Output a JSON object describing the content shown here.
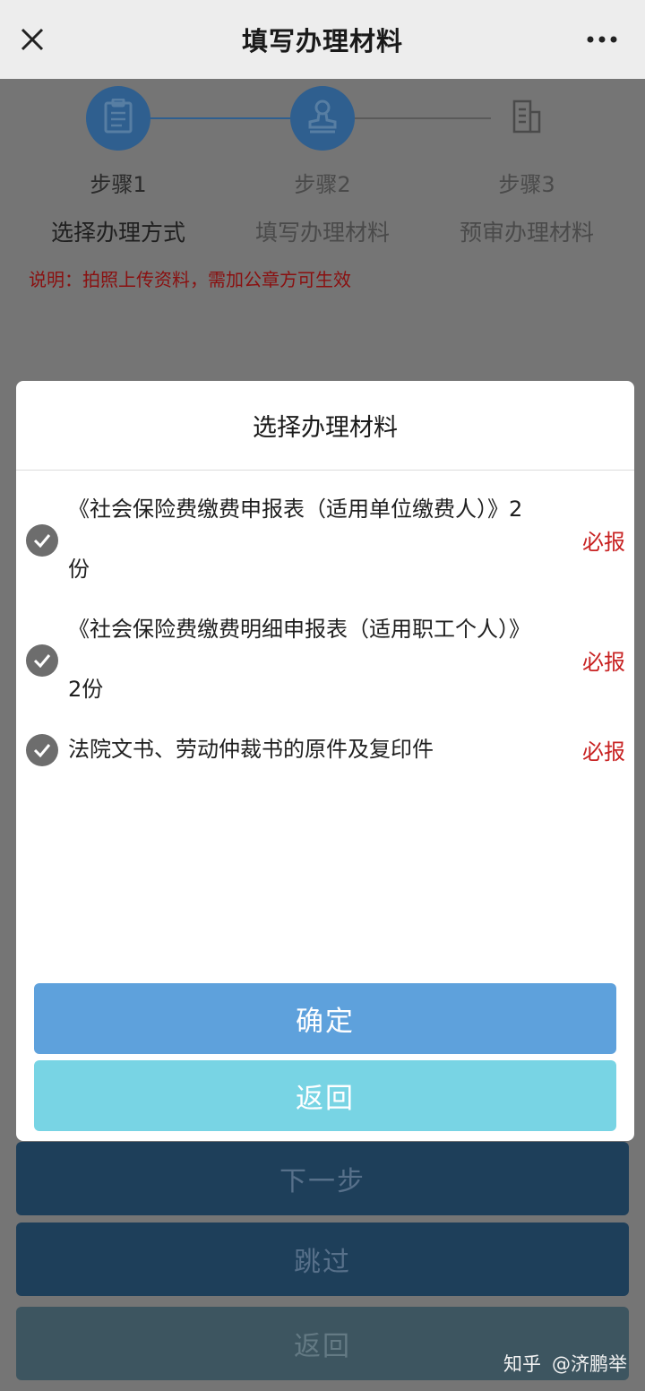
{
  "topbar": {
    "title": "填写办理材料",
    "close_icon": "close-icon",
    "more_icon": "more-icon"
  },
  "steps": [
    {
      "number": "步骤1",
      "name": "选择办理方式",
      "icon": "clipboard-icon",
      "active": true
    },
    {
      "number": "步骤2",
      "name": "填写办理材料",
      "icon": "stamp-icon",
      "active": true
    },
    {
      "number": "步骤3",
      "name": "预审办理材料",
      "icon": "document-icon",
      "active": false
    }
  ],
  "note": "说明：拍照上传资料，需加公章方可生效",
  "background_buttons": {
    "next": "下一步",
    "skip": "跳过",
    "back": "返回"
  },
  "watermark": {
    "site": "知乎",
    "author": "@济鹏举"
  },
  "modal": {
    "title": "选择办理材料",
    "items": [
      {
        "line1": "《社会保险费缴费申报表（适用单位缴费人）》2",
        "line2": "份",
        "required": "必报",
        "checked": true
      },
      {
        "line1": "《社会保险费缴费明细申报表（适用职工个人）》",
        "line2": "2份",
        "required": "必报",
        "checked": true
      },
      {
        "line1": "法院文书、劳动仲裁书的原件及复印件",
        "line2": "",
        "required": "必报",
        "checked": true
      }
    ],
    "confirm": "确定",
    "back": "返回"
  },
  "colors": {
    "confirm": "#5ea1dc",
    "back": "#78d4e4",
    "required": "#c82222",
    "step_active": "#2f5f8f"
  }
}
